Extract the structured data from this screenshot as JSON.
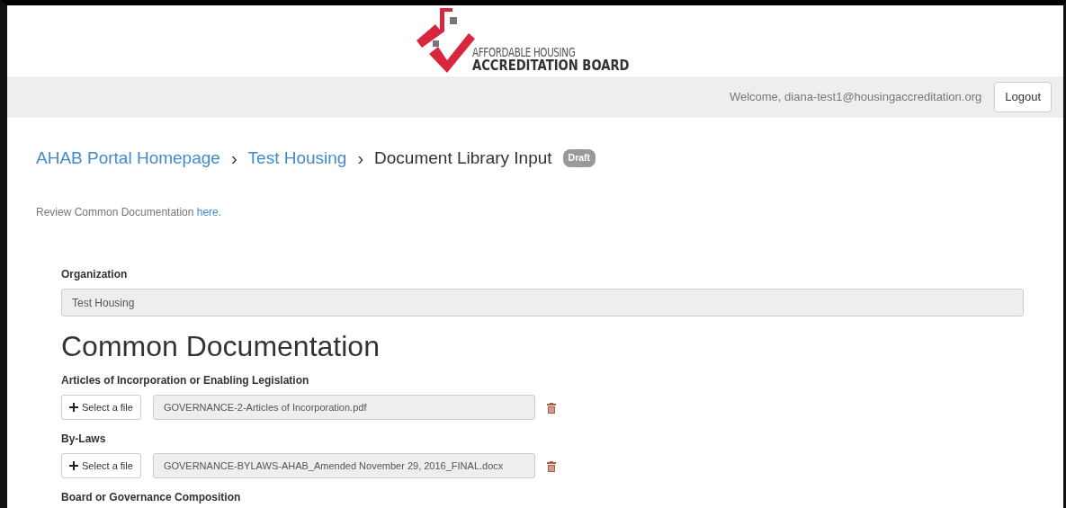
{
  "logo": {
    "line_1": "AFFORDABLE HOUSING",
    "line_2": "ACCREDITATION BOARD"
  },
  "user_bar": {
    "welcome": "Welcome, diana-test1@housingaccreditation.org",
    "logout": "Logout"
  },
  "breadcrumb": [
    {
      "label": "AHAB Portal Homepage",
      "link": true
    },
    {
      "label": "Test Housing",
      "link": true
    },
    {
      "label": "Document Library Input",
      "link": false
    }
  ],
  "separator": "›",
  "status_badge": "Draft",
  "review_note": {
    "text": "Review Common Documentation ",
    "link": "here",
    "after": "."
  },
  "organization": {
    "label": "Organization",
    "value": "Test Housing"
  },
  "section_title": "Common Documentation",
  "documents": [
    {
      "label": "Articles of Incorporation or Enabling Legislation",
      "button": "Select a file",
      "file": "GOVERNANCE-2-Articles of Incorporation.pdf"
    },
    {
      "label": "By-Laws",
      "button": "Select a file",
      "file": "GOVERNANCE-BYLAWS-AHAB_Amended November 29, 2016_FINAL.docx"
    },
    {
      "label": "Board or Governance Composition"
    }
  ]
}
